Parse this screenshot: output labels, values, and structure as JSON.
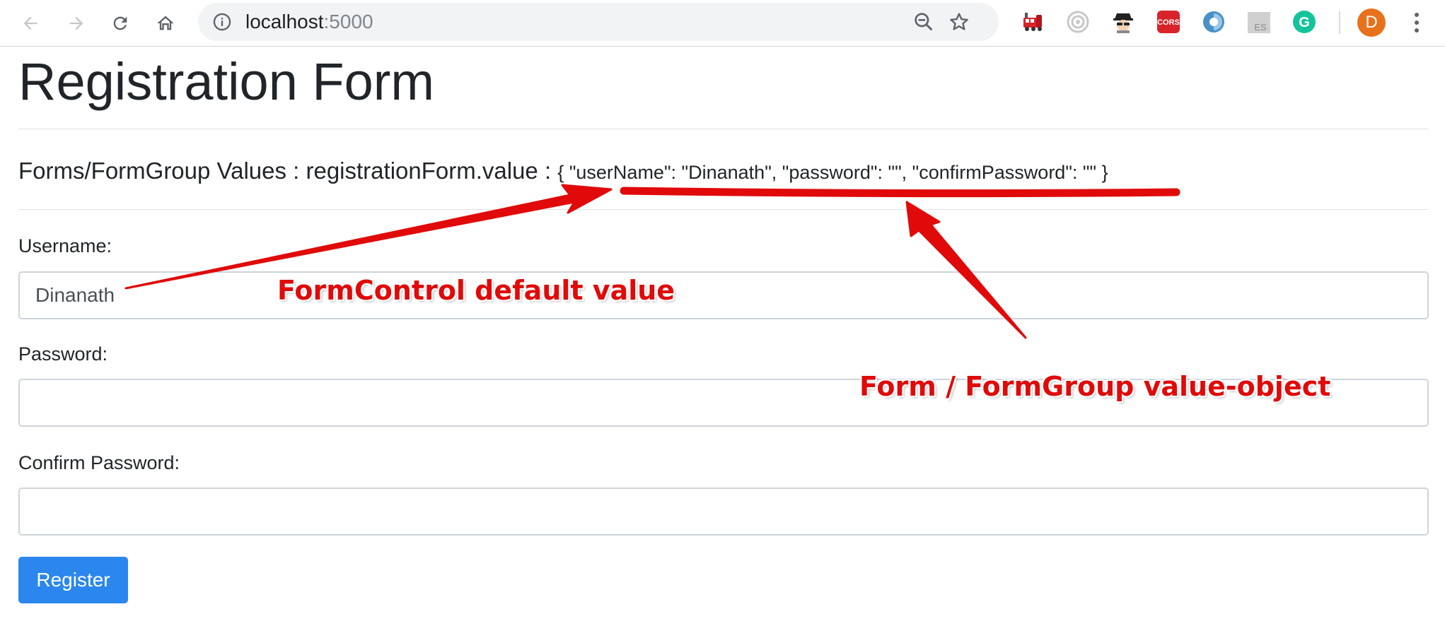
{
  "browser": {
    "url_host": "localhost",
    "url_port": ":5000",
    "profile_initial": "D",
    "extensions": [
      "train-extension-icon",
      "radar-extension-icon",
      "spy-extension-icon",
      "cors-extension-icon",
      "shield-extension-icon",
      "es-extension-icon",
      "grammarly-extension-icon"
    ],
    "cors_label": "CORS",
    "es_label": "ES",
    "grammarly_label": "G"
  },
  "page": {
    "title": "Registration Form",
    "values_prefix": "Forms/FormGroup Values : registrationForm.value :",
    "values_json": "{ \"userName\": \"Dinanath\", \"password\": \"\", \"confirmPassword\": \"\" }"
  },
  "form": {
    "username_label": "Username:",
    "username_value": "Dinanath",
    "password_label": "Password:",
    "password_value": "",
    "confirm_label": "Confirm Password:",
    "confirm_value": "",
    "submit_label": "Register"
  },
  "annotations": {
    "default_value": "FormControl default value",
    "value_object": "Form / FormGroup value-object"
  },
  "colors": {
    "accent": "#2b87ee",
    "annotation": "#e00a0a",
    "avatar": "#e8711c"
  }
}
